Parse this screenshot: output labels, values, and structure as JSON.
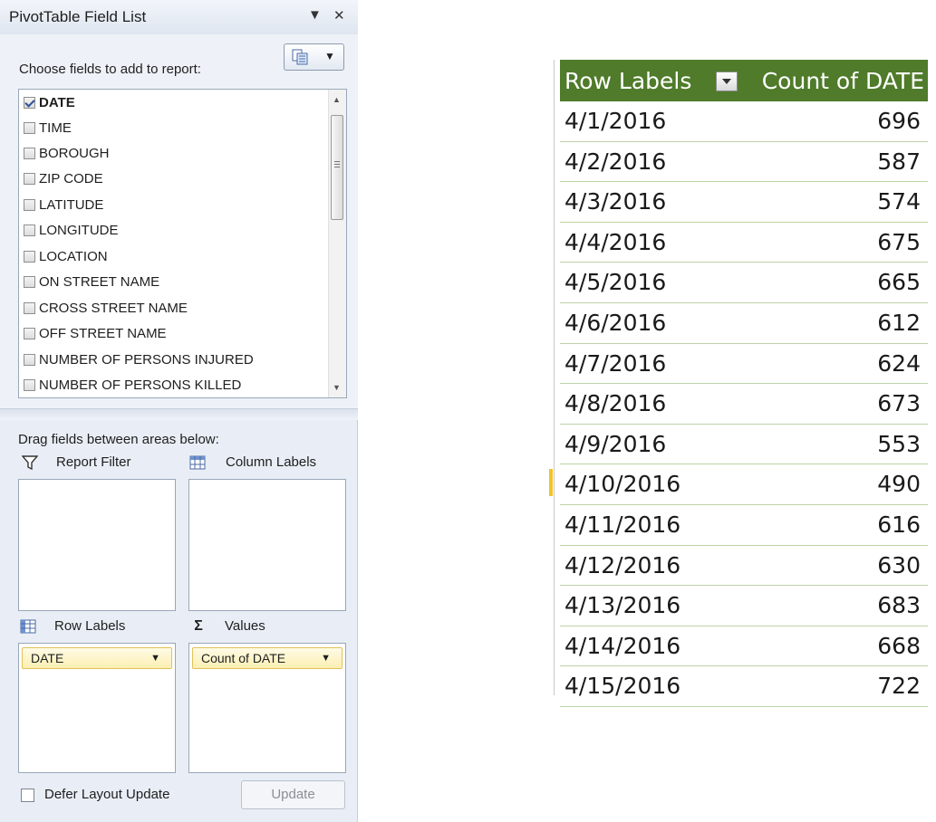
{
  "panel": {
    "title": "PivotTable Field List",
    "dropdown_glyph": "▼",
    "close_glyph": "✕",
    "choose_label": "Choose fields to add to report:",
    "layout_button_icon": "field-list-layout-icon",
    "fields": [
      {
        "label": "DATE",
        "checked": true
      },
      {
        "label": "TIME",
        "checked": false
      },
      {
        "label": "BOROUGH",
        "checked": false
      },
      {
        "label": "ZIP CODE",
        "checked": false
      },
      {
        "label": "LATITUDE",
        "checked": false
      },
      {
        "label": "LONGITUDE",
        "checked": false
      },
      {
        "label": "LOCATION",
        "checked": false
      },
      {
        "label": "ON STREET NAME",
        "checked": false
      },
      {
        "label": "CROSS STREET NAME",
        "checked": false
      },
      {
        "label": "OFF STREET NAME",
        "checked": false
      },
      {
        "label": "NUMBER OF PERSONS INJURED",
        "checked": false
      },
      {
        "label": "NUMBER OF PERSONS KILLED",
        "checked": false
      }
    ],
    "drag_label": "Drag fields between areas below:",
    "areas": {
      "report_filter": {
        "label": "Report Filter",
        "items": []
      },
      "column_labels": {
        "label": "Column Labels",
        "items": []
      },
      "row_labels": {
        "label": "Row Labels",
        "items": [
          "DATE"
        ]
      },
      "values": {
        "label": "Values",
        "items": [
          "Count of DATE"
        ]
      }
    },
    "defer_label": "Defer Layout Update",
    "defer_checked": false,
    "update_label": "Update"
  },
  "pivot": {
    "header_row_labels": "Row Labels",
    "header_value": "Count of DATE",
    "header_color": "#4f7b2a",
    "rows": [
      {
        "label": "4/1/2016",
        "value": "696"
      },
      {
        "label": "4/2/2016",
        "value": "587"
      },
      {
        "label": "4/3/2016",
        "value": "574"
      },
      {
        "label": "4/4/2016",
        "value": "675"
      },
      {
        "label": "4/5/2016",
        "value": "665"
      },
      {
        "label": "4/6/2016",
        "value": "612"
      },
      {
        "label": "4/7/2016",
        "value": "624"
      },
      {
        "label": "4/8/2016",
        "value": "673"
      },
      {
        "label": "4/9/2016",
        "value": "553"
      },
      {
        "label": "4/10/2016",
        "value": "490"
      },
      {
        "label": "4/11/2016",
        "value": "616"
      },
      {
        "label": "4/12/2016",
        "value": "630"
      },
      {
        "label": "4/13/2016",
        "value": "683"
      },
      {
        "label": "4/14/2016",
        "value": "668"
      },
      {
        "label": "4/15/2016",
        "value": "722"
      }
    ]
  }
}
